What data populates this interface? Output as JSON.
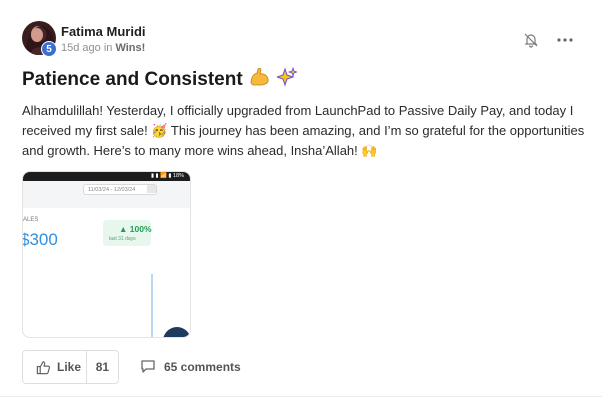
{
  "author": {
    "name": "Fatima Muridi",
    "level": "5",
    "time_ago": "15d ago in ",
    "category": "Wins!"
  },
  "post": {
    "title": "Patience and Consistent",
    "title_emojis": [
      "flexed-biceps",
      "sparkles"
    ],
    "body": "Alhamdulillah! Yesterday, I officially upgraded from LaunchPad to Passive Daily Pay, and today I received my first sale! 🥳 This journey has been amazing, and I’m so grateful for the opportunities and growth. Here’s to many more wins ahead, Insha’Allah! 🙌"
  },
  "attachment": {
    "status_text": "▮ ▮ 📶 ▮ 18%",
    "date_range": "11/03/24 - 12/03/24",
    "sales_label": "ALES",
    "sales_value": "$300",
    "pct_value": "▲ 100%",
    "pct_sub": "last 31 days"
  },
  "actions": {
    "like_label": "Like",
    "like_count": "81",
    "comments_label": "65 comments"
  },
  "icons": {
    "bell": "bell-icon",
    "more": "more-horizontal-icon",
    "like": "thumbs-up-icon",
    "comment": "comment-bubble-icon"
  },
  "colors": {
    "badge": "#3b6fd1",
    "sales_value": "#2f8fe0",
    "growth": "#1f9d55"
  }
}
